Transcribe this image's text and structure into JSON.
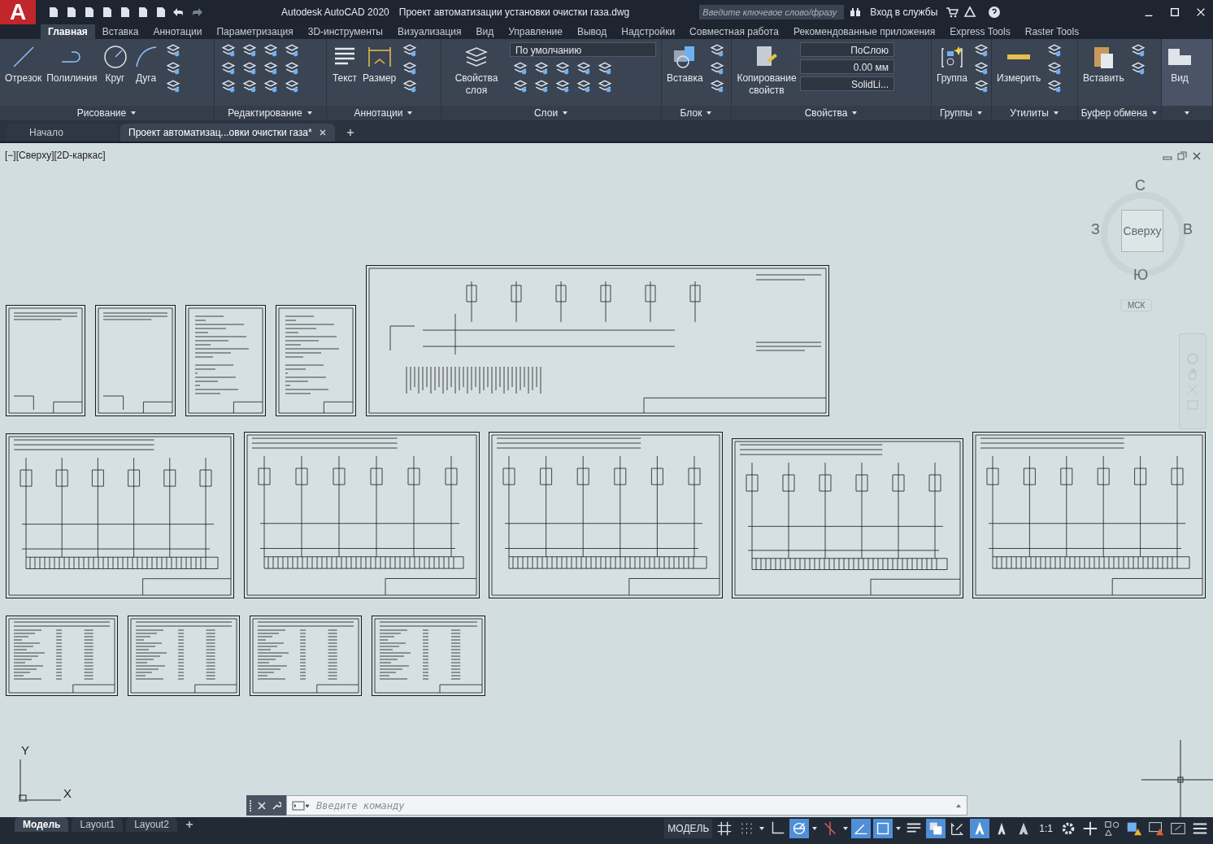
{
  "app": {
    "logo": "A"
  },
  "title_bar": {
    "app_name": "Autodesk AutoCAD 2020",
    "document": "Проект автоматизации установки очистки газа.dwg",
    "search": {
      "placeholder": "Введите ключевое слово/фразу"
    },
    "sign_in": "Вход в службы"
  },
  "ribbon": {
    "tabs": [
      {
        "label": "Главная",
        "selected": true
      },
      {
        "label": "Вставка",
        "selected": false
      },
      {
        "label": "Аннотации",
        "selected": false
      },
      {
        "label": "Параметризация",
        "selected": false
      },
      {
        "label": "3D-инструменты",
        "selected": false
      },
      {
        "label": "Визуализация",
        "selected": false
      },
      {
        "label": "Вид",
        "selected": false
      },
      {
        "label": "Управление",
        "selected": false
      },
      {
        "label": "Вывод",
        "selected": false
      },
      {
        "label": "Надстройки",
        "selected": false
      },
      {
        "label": "Совместная работа",
        "selected": false
      },
      {
        "label": "Рекомендованные приложения",
        "selected": false
      },
      {
        "label": "Express Tools",
        "selected": false
      },
      {
        "label": "Raster Tools",
        "selected": false
      }
    ],
    "panels": [
      {
        "title": "Рисование",
        "tools": [
          {
            "label": "Отрезок",
            "kind": "line"
          },
          {
            "label": "Полилиния",
            "kind": "polyline"
          },
          {
            "label": "Круг",
            "kind": "circle"
          },
          {
            "label": "Дуга",
            "kind": "arc"
          }
        ]
      },
      {
        "title": "Редактирование"
      },
      {
        "title": "Аннотации",
        "tools": [
          {
            "label": "Текст",
            "kind": "text"
          },
          {
            "label": "Размер",
            "kind": "dimension"
          }
        ]
      },
      {
        "title": "Слои",
        "tools": [
          {
            "label": "Свойства слоя",
            "kind": "layers"
          }
        ],
        "dropdowns": [
          "По умолчанию"
        ]
      },
      {
        "title": "Блок",
        "tools": [
          {
            "label": "Вставка",
            "kind": "insert"
          }
        ]
      },
      {
        "title": "Свойства",
        "tools": [
          {
            "label": "Копирование свойств",
            "kind": "match"
          }
        ],
        "dropdowns": [
          "ПоСлою",
          "0.00 мм",
          "SolidLi..."
        ]
      },
      {
        "title": "Группы",
        "tools": [
          {
            "label": "Группа",
            "kind": "group"
          }
        ]
      },
      {
        "title": "Утилиты",
        "tools": [
          {
            "label": "Измерить",
            "kind": "measure"
          }
        ]
      },
      {
        "title": "Буфер обмена",
        "tools": [
          {
            "label": "Вставить",
            "kind": "paste"
          }
        ]
      },
      {
        "tools": [
          {
            "label": "Вид",
            "kind": "view"
          }
        ]
      }
    ]
  },
  "file_tabs": [
    {
      "label": "Начало",
      "selected": false
    },
    {
      "label": "Проект автоматизац...овки очистки газа*",
      "selected": true
    }
  ],
  "viewport": {
    "label": "[−][Сверху][2D-каркас]",
    "viewcube": {
      "north": "С",
      "west": "З",
      "east": "В",
      "south": "Ю",
      "face": "Сверху",
      "ucs": "МСК"
    },
    "ucs_icon": {
      "y": "Y",
      "x": "X"
    },
    "command_line": {
      "placeholder": "Введите команду"
    }
  },
  "layout_tabs": [
    {
      "label": "Модель",
      "selected": true
    },
    {
      "label": "Layout1",
      "selected": false
    },
    {
      "label": "Layout2",
      "selected": false
    }
  ],
  "status_bar": {
    "model": "МОДЕЛЬ",
    "scale": "1:1",
    "toggles": [
      {
        "kind": "grid",
        "on": false
      },
      {
        "kind": "snap",
        "on": false
      },
      {
        "kind": "ortho",
        "on": false
      },
      {
        "kind": "polar",
        "on": true
      },
      {
        "kind": "isodraft",
        "on": false
      },
      {
        "kind": "otrack",
        "on": true
      },
      {
        "kind": "osnap",
        "on": true
      },
      {
        "kind": "lineweight",
        "on": false
      },
      {
        "kind": "transparency",
        "on": true
      },
      {
        "kind": "cycling",
        "on": false
      },
      {
        "kind": "annovis",
        "on": true
      },
      {
        "kind": "autoscale",
        "on": false
      },
      {
        "kind": "annoscale",
        "on": false
      }
    ]
  }
}
